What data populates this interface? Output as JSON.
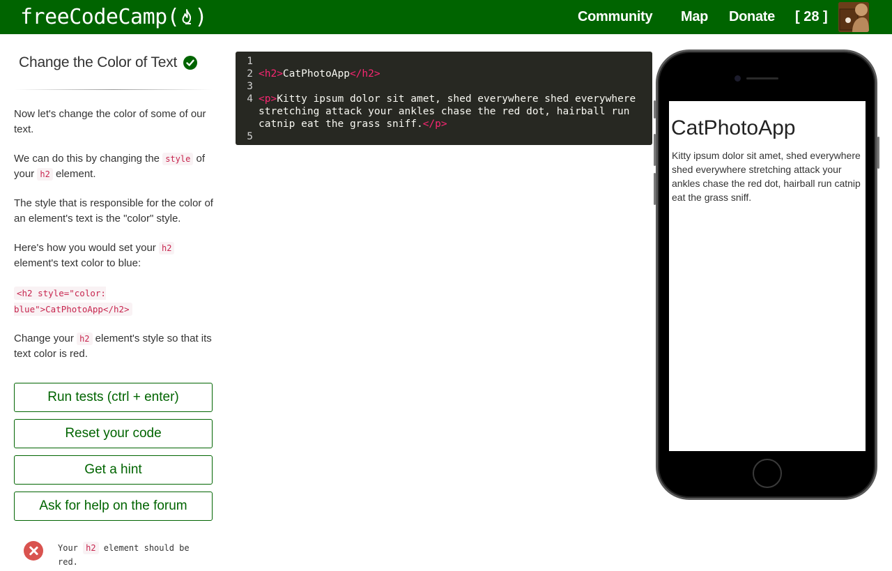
{
  "navbar": {
    "brand_prefix": "freeCodeCamp(",
    "brand_suffix": ")",
    "links": [
      "Community",
      "Map",
      "Donate"
    ],
    "points": "[ 28 ]"
  },
  "challenge": {
    "title": "Change the Color of Text",
    "completed": true,
    "description": {
      "p1": "Now let's change the color of some of our text.",
      "p2_a": "We can do this by changing the ",
      "p2_code": "style",
      "p2_b": " of your ",
      "p2_code2": "h2",
      "p2_c": " element.",
      "p3": "The style that is responsible for the color of an element's text is the \"color\" style.",
      "p4_a": "Here's how you would set your ",
      "p4_code": "h2",
      "p4_b": " element's text color to blue:",
      "example": "<h2 style=\"color: blue\">CatPhotoApp</h2>",
      "p5_a": "Change your ",
      "p5_code": "h2",
      "p5_b": " element's style so that its text color is red."
    },
    "buttons": {
      "run": "Run tests (ctrl + enter)",
      "reset": "Reset your code",
      "hint": "Get a hint",
      "help": "Ask for help on the forum"
    },
    "test": {
      "text_a": "Your ",
      "text_code": "h2",
      "text_b": " element should be red.",
      "status": "fail"
    }
  },
  "editor": {
    "lines": [
      {
        "n": "1",
        "parts": []
      },
      {
        "n": "2",
        "parts": [
          {
            "t": "<h2>",
            "c": "tag"
          },
          {
            "t": "CatPhotoApp",
            "c": "text"
          },
          {
            "t": "</h2>",
            "c": "tag"
          }
        ]
      },
      {
        "n": "3",
        "parts": []
      },
      {
        "n": "4",
        "parts": [
          {
            "t": "<p>",
            "c": "tag"
          },
          {
            "t": "Kitty ipsum dolor sit amet, shed everywhere shed everywhere stretching attack your ankles chase the red dot, hairball run catnip eat the grass sniff.",
            "c": "text"
          },
          {
            "t": "</p>",
            "c": "tag"
          }
        ]
      },
      {
        "n": "5",
        "parts": []
      }
    ]
  },
  "preview": {
    "heading": "CatPhotoApp",
    "paragraph": "Kitty ipsum dolor sit amet, shed everywhere shed everywhere stretching attack your ankles chase the red dot, hairball run catnip eat the grass sniff."
  },
  "colors": {
    "brand_green": "#006400",
    "editor_bg": "#272822",
    "tag": "#f92672",
    "fail": "#d9534f",
    "check": "#006400"
  }
}
